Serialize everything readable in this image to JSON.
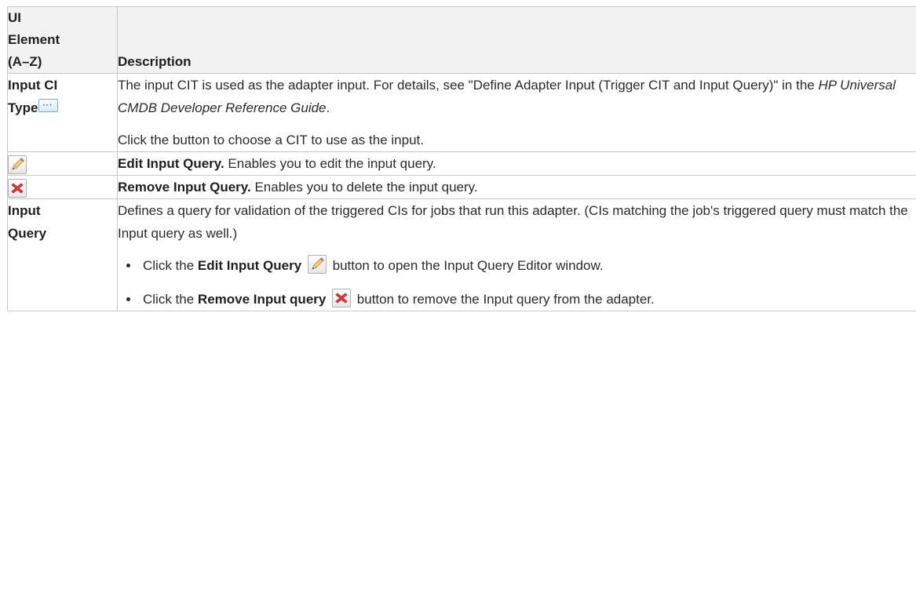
{
  "table": {
    "header": {
      "col1": [
        "UI",
        "Element",
        "(A–Z)"
      ],
      "col2": "Description"
    },
    "rows": {
      "input_ci_type": {
        "label_line1": "Input CI",
        "label_line2": "Type",
        "desc1_pre": "The input CIT is used as the adapter input. For details, see \"Define Adapter Input (Trigger CIT and Input Query)\" in the ",
        "desc1_italic": "HP Universal CMDB Developer Reference Guide",
        "desc1_post": ".",
        "desc2": "Click the button to choose a CIT to use as the input."
      },
      "edit_input_query": {
        "bold": "Edit Input Query.",
        "text": " Enables you to edit the input query."
      },
      "remove_input_query": {
        "bold": "Remove Input Query.",
        "text": " Enables you to delete the input query."
      },
      "input_query": {
        "label_line1": "Input",
        "label_line2": "Query",
        "desc": "Defines a query for validation of the triggered CIs for jobs that run this adapter. (CIs matching the job's triggered query must match the Input query as well.)",
        "bullet1_pre": "Click the ",
        "bullet1_bold": "Edit Input Query",
        "bullet1_post": " button to open the Input Query Editor window.",
        "bullet2_pre": "Click the ",
        "bullet2_bold": "Remove Input query",
        "bullet2_post": " button to remove the Input query from the adapter."
      }
    }
  },
  "icons": {
    "browse": "browse-ellipsis-icon",
    "edit": "pencil-icon",
    "remove": "red-x-icon"
  },
  "colors": {
    "border": "#c8c8c8",
    "header_bg": "#f2f2f2",
    "text": "#2b2b2b"
  }
}
